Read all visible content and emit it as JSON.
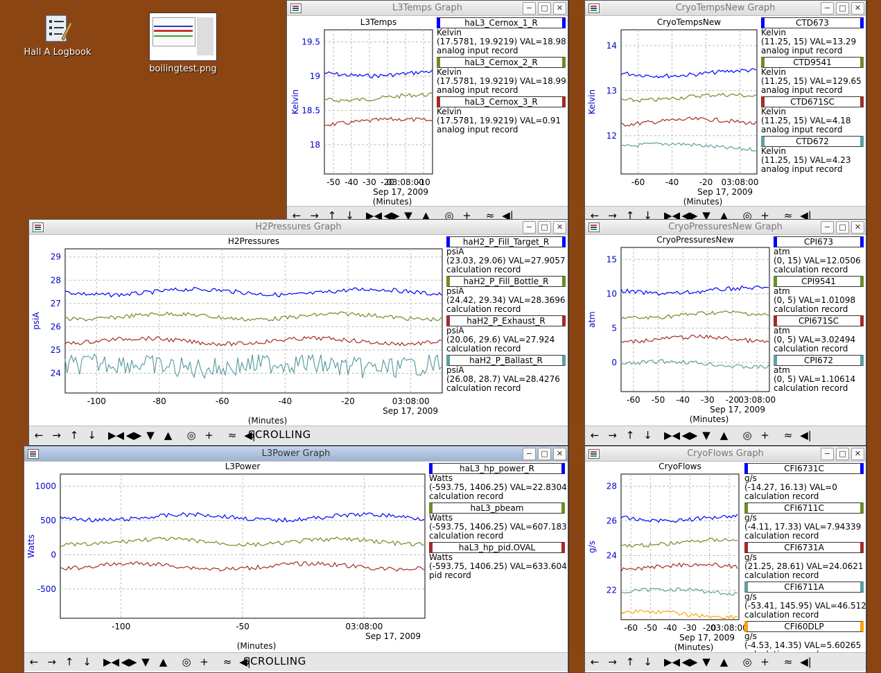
{
  "desktop": {
    "logbook_label": "Hall A Logbook",
    "png_label": "boilingtest.png"
  },
  "windows": {
    "l3temps": {
      "title": "L3Temps Graph",
      "chart_title": "L3Temps",
      "ylabel": "Kelvin",
      "yticks": [
        "19.5",
        "19",
        "18.5",
        "18"
      ],
      "xticks": [
        "-50",
        "-40",
        "-30",
        "-20",
        "03:08:00",
        "-10"
      ],
      "date": "Sep 17, 2009",
      "xlabel": "(Minutes)",
      "legend": [
        {
          "name": "haL3_Cernox_1_R",
          "units": "Kelvin",
          "range": "(17.5781, 19.9219) VAL=18.98",
          "rtype": "analog input record",
          "color": "#0000ff"
        },
        {
          "name": "haL3_Cernox_2_R",
          "units": "Kelvin",
          "range": "(17.5781, 19.9219) VAL=18.99",
          "rtype": "analog input record",
          "color": "#6b8e23"
        },
        {
          "name": "haL3_Cernox_3_R",
          "units": "Kelvin",
          "range": "(17.5781, 19.9219) VAL=0.91",
          "rtype": "analog input record",
          "color": "#a52a2a"
        }
      ]
    },
    "cryotemps": {
      "title": "CryoTempsNew Graph",
      "chart_title": "CryoTempsNew",
      "ylabel": "Kelvin",
      "yticks": [
        "14",
        "13",
        "12"
      ],
      "xticks": [
        "-60",
        "-40",
        "-20",
        "03:08:00"
      ],
      "date": "Sep 17, 2009",
      "xlabel": "(Minutes)",
      "legend": [
        {
          "name": "CTD673",
          "units": "Kelvin",
          "range": "(11.25, 15) VAL=13.29",
          "rtype": "analog input record",
          "color": "#0000ff"
        },
        {
          "name": "CTD9541",
          "units": "Kelvin",
          "range": "(11.25, 15) VAL=129.65",
          "rtype": "analog input record",
          "color": "#6b8e23"
        },
        {
          "name": "CTD671SC",
          "units": "Kelvin",
          "range": "(11.25, 15) VAL=4.18",
          "rtype": "analog input record",
          "color": "#a52a2a"
        },
        {
          "name": "CTD672",
          "units": "Kelvin",
          "range": "(11.25, 15) VAL=4.23",
          "rtype": "analog input record",
          "color": "#5f9ea0"
        }
      ]
    },
    "h2pressures": {
      "title": "H2Pressures Graph",
      "chart_title": "H2Pressures",
      "ylabel": "psiA",
      "yticks": [
        "29",
        "28",
        "27",
        "26",
        "25",
        "24"
      ],
      "xticks": [
        "-100",
        "-80",
        "-60",
        "-40",
        "-20",
        "03:08:00"
      ],
      "date": "Sep 17, 2009",
      "xlabel": "(Minutes)",
      "scrolling": "SCROLLING",
      "legend": [
        {
          "name": "haH2_P_Fill_Target_R",
          "units": "psiA",
          "range": "(23.03, 29.06) VAL=27.9057",
          "rtype": "calculation record",
          "color": "#0000ff"
        },
        {
          "name": "haH2_P_Fill_Bottle_R",
          "units": "psiA",
          "range": "(24.42, 29.34) VAL=28.3696",
          "rtype": "calculation record",
          "color": "#6b8e23"
        },
        {
          "name": "haH2_P_Exhaust_R",
          "units": "psiA",
          "range": "(20.06, 29.6) VAL=27.924",
          "rtype": "calculation record",
          "color": "#a52a2a"
        },
        {
          "name": "haH2_P_Ballast_R",
          "units": "psiA",
          "range": "(26.08, 28.7) VAL=28.4276",
          "rtype": "calculation record",
          "color": "#5f9ea0"
        }
      ]
    },
    "cryopressures": {
      "title": "CryoPressuresNew Graph",
      "chart_title": "CryoPressuresNew",
      "ylabel": "atm",
      "yticks": [
        "15",
        "10",
        "5",
        "0"
      ],
      "xticks": [
        "-60",
        "-50",
        "-40",
        "-30",
        "-20",
        "03:08:00"
      ],
      "date": "Sep 17, 2009",
      "xlabel": "(Minutes)",
      "legend": [
        {
          "name": "CPI673",
          "units": "atm",
          "range": "(0, 15) VAL=12.0506",
          "rtype": "calculation record",
          "color": "#0000ff"
        },
        {
          "name": "CPI9541",
          "units": "atm",
          "range": "(0, 5) VAL=1.01098",
          "rtype": "calculation record",
          "color": "#6b8e23"
        },
        {
          "name": "CPI671SC",
          "units": "atm",
          "range": "(0, 5) VAL=3.02494",
          "rtype": "calculation record",
          "color": "#a52a2a"
        },
        {
          "name": "CPI672",
          "units": "atm",
          "range": "(0, 5) VAL=1.10614",
          "rtype": "calculation record",
          "color": "#5f9ea0"
        }
      ]
    },
    "l3power": {
      "title": "L3Power Graph",
      "chart_title": "L3Power",
      "ylabel": "Watts",
      "yticks": [
        "1000",
        "500",
        "0",
        "-500"
      ],
      "xticks": [
        "-100",
        "-50",
        "03:08:00"
      ],
      "date": "Sep 17, 2009",
      "xlabel": "(Minutes)",
      "scrolling": "SCROLLING",
      "legend": [
        {
          "name": "haL3_hp_power_R",
          "units": "Watts",
          "range": "(-593.75, 1406.25) VAL=22.8304",
          "rtype": "calculation record",
          "color": "#0000ff"
        },
        {
          "name": "haL3_pbeam",
          "units": "Watts",
          "range": "(-593.75, 1406.25) VAL=607.183",
          "rtype": "calculation record",
          "color": "#6b8e23"
        },
        {
          "name": "haL3_hp_pid.OVAL",
          "units": "Watts",
          "range": "(-593.75, 1406.25) VAL=633.604",
          "rtype": "pid record",
          "color": "#a52a2a"
        }
      ]
    },
    "cryoflows": {
      "title": "CryoFlows Graph",
      "chart_title": "CryoFlows",
      "ylabel": "g/s",
      "yticks": [
        "28",
        "26",
        "24",
        "22"
      ],
      "xticks": [
        "-60",
        "-50",
        "-40",
        "-30",
        "-20",
        "03:08:00"
      ],
      "date": "Sep 17, 2009",
      "xlabel": "(Minutes)",
      "legend": [
        {
          "name": "CFI6731C",
          "units": "g/s",
          "range": "(-14.27, 16.13) VAL=0",
          "rtype": "calculation record",
          "color": "#0000ff"
        },
        {
          "name": "CFI6711C",
          "units": "g/s",
          "range": "(-4.11, 17.33) VAL=7.94339",
          "rtype": "calculation record",
          "color": "#6b8e23"
        },
        {
          "name": "CFI6731A",
          "units": "g/s",
          "range": "(21.25, 28.61) VAL=24.0621",
          "rtype": "calculation record",
          "color": "#a52a2a"
        },
        {
          "name": "CFI6711A",
          "units": "g/s",
          "range": "(-53.41, 145.95) VAL=46.512",
          "rtype": "calculation record",
          "color": "#5f9ea0"
        },
        {
          "name": "CFI60DLP",
          "units": "g/s",
          "range": "(-4.53, 14.35) VAL=5.60265",
          "rtype": "calculation record",
          "color": "#ffa500"
        }
      ]
    }
  },
  "toolbar_icons": [
    "arrow-left-icon",
    "arrow-right-icon",
    "arrow-up-icon",
    "arrow-down-icon",
    "zoom-x-in-icon",
    "zoom-x-out-icon",
    "zoom-y-in-icon",
    "zoom-y-out-icon",
    "reset-icon",
    "add-icon",
    "autoscale-icon",
    "scroll-icon"
  ]
}
